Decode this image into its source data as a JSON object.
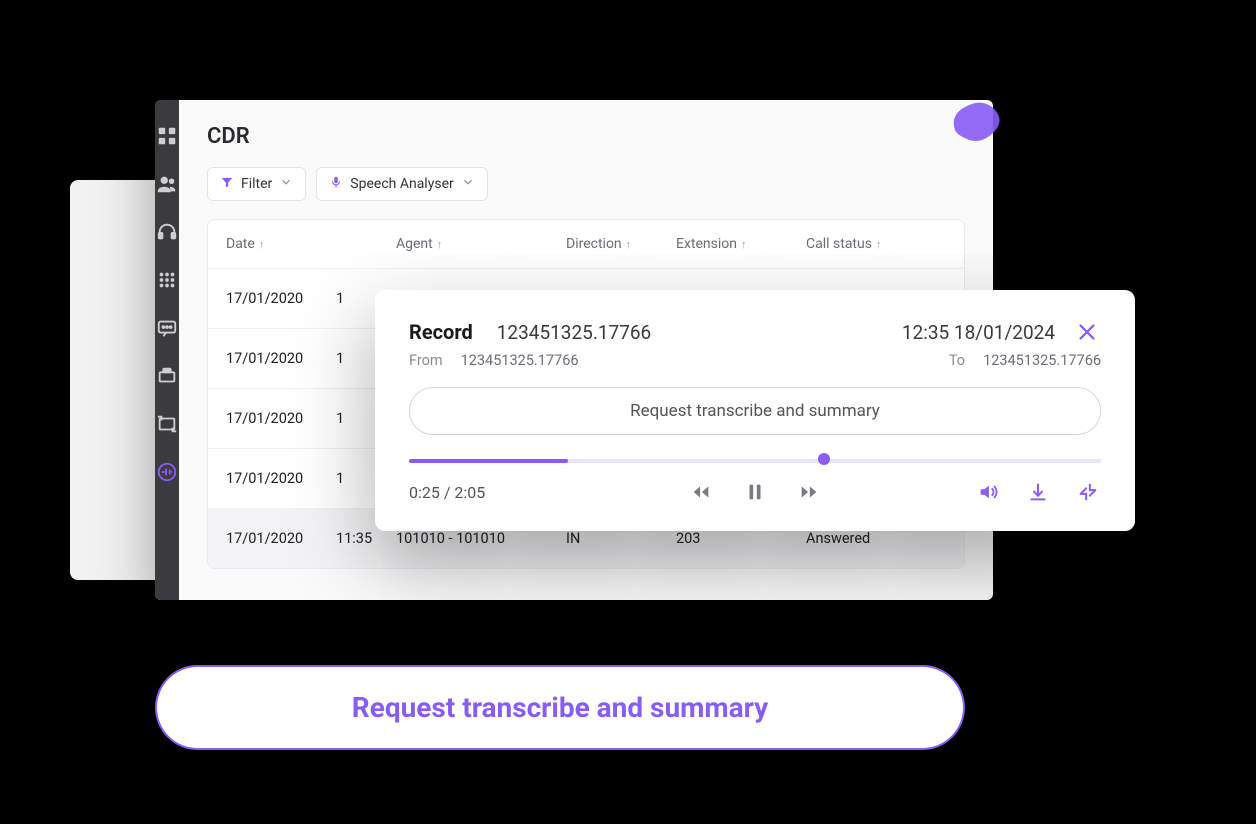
{
  "page": {
    "title": "CDR"
  },
  "toolbar": {
    "filter_label": "Filter",
    "speech_label": "Speech Analyser"
  },
  "table": {
    "headers": {
      "date": "Date",
      "agent": "Agent",
      "direction": "Direction",
      "extension": "Extension",
      "call_status": "Call status"
    },
    "rows": [
      {
        "date": "17/01/2020",
        "time": "1"
      },
      {
        "date": "17/01/2020",
        "time": "1"
      },
      {
        "date": "17/01/2020",
        "time": "1"
      },
      {
        "date": "17/01/2020",
        "time": "1"
      },
      {
        "date": "17/01/2020",
        "time": "11:35",
        "agent": "101010 - 101010",
        "direction": "IN",
        "extension": "203",
        "status": "Answered"
      }
    ]
  },
  "player": {
    "record_label": "Record",
    "record_id": "123451325.17766",
    "datetime": "12:35 18/01/2024",
    "from_label": "From",
    "from_value": "123451325.17766",
    "to_label": "To",
    "to_value": "123451325.17766",
    "request_label": "Request transcribe and summary",
    "progress_percent": 23,
    "scrub_percent": 60,
    "time_display": "0:25 / 2:05"
  },
  "big_button": {
    "label": "Request transcribe and summary"
  },
  "colors": {
    "accent": "#8a5cf6"
  }
}
